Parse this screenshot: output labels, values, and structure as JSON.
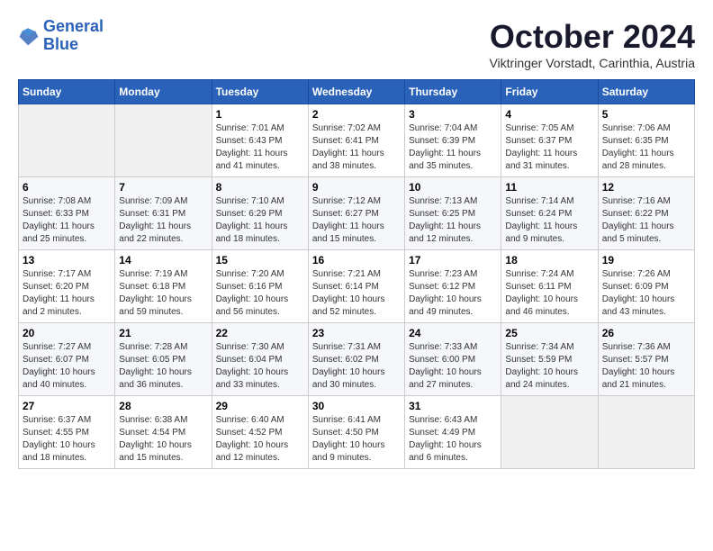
{
  "logo": {
    "line1": "General",
    "line2": "Blue"
  },
  "title": "October 2024",
  "subtitle": "Viktringer Vorstadt, Carinthia, Austria",
  "days_of_week": [
    "Sunday",
    "Monday",
    "Tuesday",
    "Wednesday",
    "Thursday",
    "Friday",
    "Saturday"
  ],
  "weeks": [
    [
      null,
      null,
      {
        "day": "1",
        "sunrise": "Sunrise: 7:01 AM",
        "sunset": "Sunset: 6:43 PM",
        "daylight": "Daylight: 11 hours and 41 minutes."
      },
      {
        "day": "2",
        "sunrise": "Sunrise: 7:02 AM",
        "sunset": "Sunset: 6:41 PM",
        "daylight": "Daylight: 11 hours and 38 minutes."
      },
      {
        "day": "3",
        "sunrise": "Sunrise: 7:04 AM",
        "sunset": "Sunset: 6:39 PM",
        "daylight": "Daylight: 11 hours and 35 minutes."
      },
      {
        "day": "4",
        "sunrise": "Sunrise: 7:05 AM",
        "sunset": "Sunset: 6:37 PM",
        "daylight": "Daylight: 11 hours and 31 minutes."
      },
      {
        "day": "5",
        "sunrise": "Sunrise: 7:06 AM",
        "sunset": "Sunset: 6:35 PM",
        "daylight": "Daylight: 11 hours and 28 minutes."
      }
    ],
    [
      {
        "day": "6",
        "sunrise": "Sunrise: 7:08 AM",
        "sunset": "Sunset: 6:33 PM",
        "daylight": "Daylight: 11 hours and 25 minutes."
      },
      {
        "day": "7",
        "sunrise": "Sunrise: 7:09 AM",
        "sunset": "Sunset: 6:31 PM",
        "daylight": "Daylight: 11 hours and 22 minutes."
      },
      {
        "day": "8",
        "sunrise": "Sunrise: 7:10 AM",
        "sunset": "Sunset: 6:29 PM",
        "daylight": "Daylight: 11 hours and 18 minutes."
      },
      {
        "day": "9",
        "sunrise": "Sunrise: 7:12 AM",
        "sunset": "Sunset: 6:27 PM",
        "daylight": "Daylight: 11 hours and 15 minutes."
      },
      {
        "day": "10",
        "sunrise": "Sunrise: 7:13 AM",
        "sunset": "Sunset: 6:25 PM",
        "daylight": "Daylight: 11 hours and 12 minutes."
      },
      {
        "day": "11",
        "sunrise": "Sunrise: 7:14 AM",
        "sunset": "Sunset: 6:24 PM",
        "daylight": "Daylight: 11 hours and 9 minutes."
      },
      {
        "day": "12",
        "sunrise": "Sunrise: 7:16 AM",
        "sunset": "Sunset: 6:22 PM",
        "daylight": "Daylight: 11 hours and 5 minutes."
      }
    ],
    [
      {
        "day": "13",
        "sunrise": "Sunrise: 7:17 AM",
        "sunset": "Sunset: 6:20 PM",
        "daylight": "Daylight: 11 hours and 2 minutes."
      },
      {
        "day": "14",
        "sunrise": "Sunrise: 7:19 AM",
        "sunset": "Sunset: 6:18 PM",
        "daylight": "Daylight: 10 hours and 59 minutes."
      },
      {
        "day": "15",
        "sunrise": "Sunrise: 7:20 AM",
        "sunset": "Sunset: 6:16 PM",
        "daylight": "Daylight: 10 hours and 56 minutes."
      },
      {
        "day": "16",
        "sunrise": "Sunrise: 7:21 AM",
        "sunset": "Sunset: 6:14 PM",
        "daylight": "Daylight: 10 hours and 52 minutes."
      },
      {
        "day": "17",
        "sunrise": "Sunrise: 7:23 AM",
        "sunset": "Sunset: 6:12 PM",
        "daylight": "Daylight: 10 hours and 49 minutes."
      },
      {
        "day": "18",
        "sunrise": "Sunrise: 7:24 AM",
        "sunset": "Sunset: 6:11 PM",
        "daylight": "Daylight: 10 hours and 46 minutes."
      },
      {
        "day": "19",
        "sunrise": "Sunrise: 7:26 AM",
        "sunset": "Sunset: 6:09 PM",
        "daylight": "Daylight: 10 hours and 43 minutes."
      }
    ],
    [
      {
        "day": "20",
        "sunrise": "Sunrise: 7:27 AM",
        "sunset": "Sunset: 6:07 PM",
        "daylight": "Daylight: 10 hours and 40 minutes."
      },
      {
        "day": "21",
        "sunrise": "Sunrise: 7:28 AM",
        "sunset": "Sunset: 6:05 PM",
        "daylight": "Daylight: 10 hours and 36 minutes."
      },
      {
        "day": "22",
        "sunrise": "Sunrise: 7:30 AM",
        "sunset": "Sunset: 6:04 PM",
        "daylight": "Daylight: 10 hours and 33 minutes."
      },
      {
        "day": "23",
        "sunrise": "Sunrise: 7:31 AM",
        "sunset": "Sunset: 6:02 PM",
        "daylight": "Daylight: 10 hours and 30 minutes."
      },
      {
        "day": "24",
        "sunrise": "Sunrise: 7:33 AM",
        "sunset": "Sunset: 6:00 PM",
        "daylight": "Daylight: 10 hours and 27 minutes."
      },
      {
        "day": "25",
        "sunrise": "Sunrise: 7:34 AM",
        "sunset": "Sunset: 5:59 PM",
        "daylight": "Daylight: 10 hours and 24 minutes."
      },
      {
        "day": "26",
        "sunrise": "Sunrise: 7:36 AM",
        "sunset": "Sunset: 5:57 PM",
        "daylight": "Daylight: 10 hours and 21 minutes."
      }
    ],
    [
      {
        "day": "27",
        "sunrise": "Sunrise: 6:37 AM",
        "sunset": "Sunset: 4:55 PM",
        "daylight": "Daylight: 10 hours and 18 minutes."
      },
      {
        "day": "28",
        "sunrise": "Sunrise: 6:38 AM",
        "sunset": "Sunset: 4:54 PM",
        "daylight": "Daylight: 10 hours and 15 minutes."
      },
      {
        "day": "29",
        "sunrise": "Sunrise: 6:40 AM",
        "sunset": "Sunset: 4:52 PM",
        "daylight": "Daylight: 10 hours and 12 minutes."
      },
      {
        "day": "30",
        "sunrise": "Sunrise: 6:41 AM",
        "sunset": "Sunset: 4:50 PM",
        "daylight": "Daylight: 10 hours and 9 minutes."
      },
      {
        "day": "31",
        "sunrise": "Sunrise: 6:43 AM",
        "sunset": "Sunset: 4:49 PM",
        "daylight": "Daylight: 10 hours and 6 minutes."
      },
      null,
      null
    ]
  ]
}
